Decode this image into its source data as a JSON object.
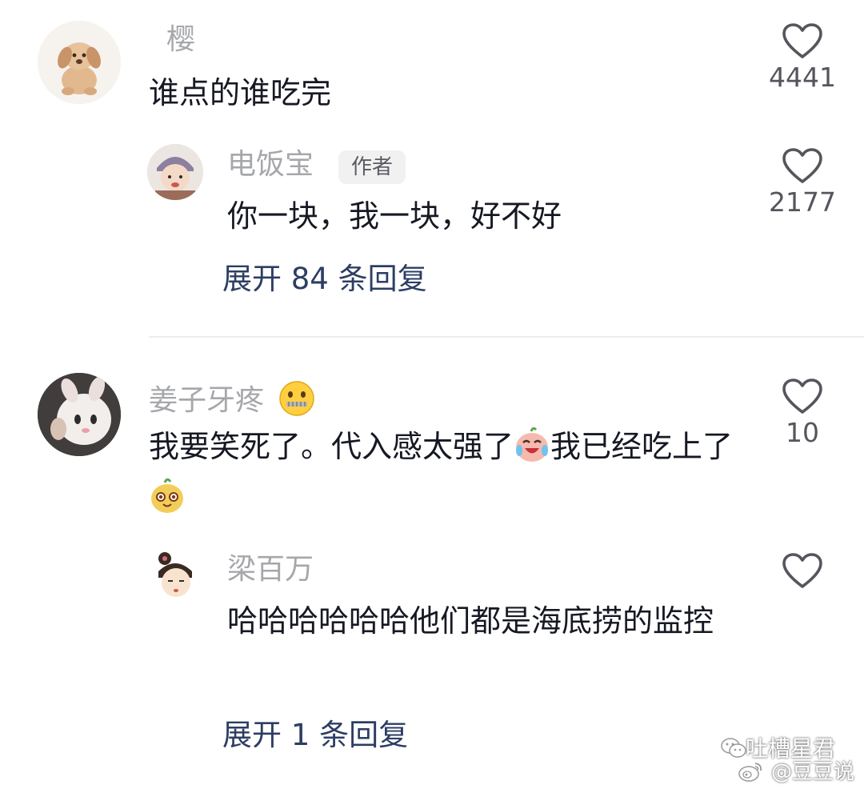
{
  "comments": [
    {
      "username": "樱",
      "text": "谁点的谁吃完",
      "likes": "4441",
      "replies": [
        {
          "username": "电饭宝",
          "badge": "作者",
          "text": "你一块，我一块，好不好",
          "likes": "2177"
        }
      ],
      "expand_label": "展开 84 条回复"
    },
    {
      "username": "姜子牙疼",
      "text_part1": "我要笑死了。代入感太强了",
      "text_part2": "我已经吃上了",
      "likes": "10",
      "replies": [
        {
          "username": "梁百万",
          "text": "哈哈哈哈哈哈他们都是海底捞的监控"
        }
      ],
      "expand_label": "展开 1 条回复"
    }
  ],
  "watermark": {
    "line1": "吐槽星君",
    "line2": "@豆豆说"
  },
  "colors": {
    "username": "#a6a7ab",
    "text": "#161823",
    "link": "#2d3e63",
    "like_count": "#55565c"
  }
}
